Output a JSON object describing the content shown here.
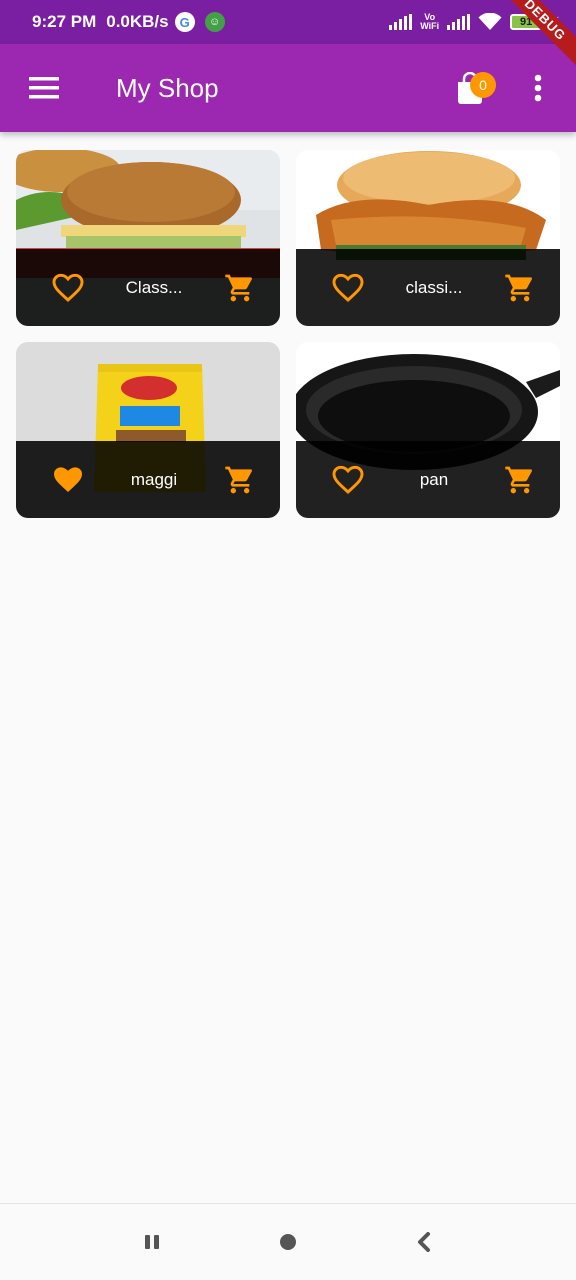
{
  "status_bar": {
    "time": "9:27 PM",
    "net_speed": "0.0KB/s",
    "google_badge": "G",
    "volte_line1": "Vo",
    "volte_line2": "WiFi",
    "battery": "91",
    "debug_label": "DEBUG"
  },
  "app_bar": {
    "title": "My Shop",
    "cart_count": "0",
    "icons": {
      "menu": "menu-icon",
      "cart": "shopping-bag-icon",
      "more": "more-vert-icon"
    }
  },
  "products": [
    {
      "name": "Class...",
      "favorite": false,
      "image": "sandwich"
    },
    {
      "name": "classi...",
      "favorite": false,
      "image": "chicken-burger"
    },
    {
      "name": "maggi",
      "favorite": true,
      "image": "noodles-pack"
    },
    {
      "name": "pan",
      "favorite": false,
      "image": "frying-pan"
    }
  ],
  "colors": {
    "status_bar": "#7b1fa2",
    "app_bar": "#9c27b0",
    "accent": "#ff9800",
    "tile_footer": "#1e1e1e",
    "background": "#fafafa"
  },
  "nav_bar": {
    "icons": [
      "recents-icon",
      "home-icon",
      "back-icon"
    ]
  }
}
